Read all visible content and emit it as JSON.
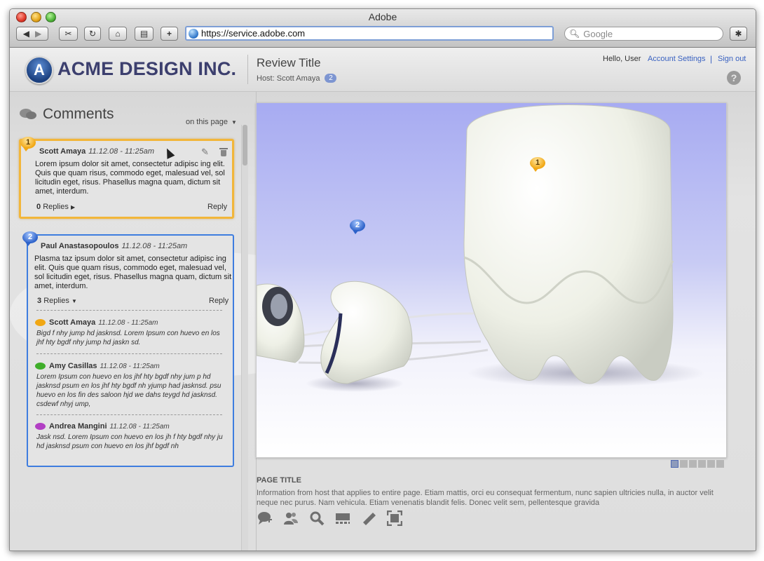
{
  "window": {
    "title": "Adobe"
  },
  "toolbar": {
    "url": "https://service.adobe.com",
    "search_placeholder": "Google",
    "buttons": [
      "back-icon",
      "forward-icon",
      "snippet-icon",
      "reload-icon",
      "home-icon",
      "print-icon",
      "add-tab-icon",
      "bug-icon"
    ]
  },
  "header": {
    "brand": "ACME DESIGN INC.",
    "review_title": "Review Title",
    "host_label": "Host: Scott Amaya",
    "host_count": "2",
    "greeting": "Hello, User",
    "account_settings": "Account Settings",
    "separator": "|",
    "sign_out": "Sign out",
    "help": "?"
  },
  "comments": {
    "title": "Comments",
    "filter": "on this page",
    "items": [
      {
        "number": "1",
        "author": "Scott Amaya",
        "time": "11.12.08 - 11:25am",
        "body": "Lorem ipsum dolor sit amet, consectetur adipisc ing elit. Quis que quam risus, commodo eget, malesuad vel, sol licitudin eget, risus. Phasellus magna quam, dictum sit amet, interdum.",
        "replies_count": "0",
        "replies_label": "Replies",
        "reply_label": "Reply"
      },
      {
        "number": "2",
        "author": "Paul Anastasopoulos",
        "time": "11.12.08 - 11:25am",
        "body": "Plasma taz ipsum dolor sit amet, consectetur adipisc ing elit. Quis que quam risus, commodo eget, malesuad vel, sol licitudin eget, risus. Phasellus magna quam, dictum sit amet, interdum.",
        "replies_count": "3",
        "replies_label": "Replies",
        "reply_label": "Reply",
        "replies": [
          {
            "author": "Scott Amaya",
            "time": "11.12.08 - 11:25am",
            "body": "Bigd f nhy jump hd jasknsd. Lorem Ipsum con huevo en los jhf hty bgdf nhy jump hd jaskn sd.",
            "color": "#f1a714"
          },
          {
            "author": "Amy Casillas",
            "time": "11.12.08 - 11:25am",
            "body": "Lorem Ipsum con huevo en los jhf hty bgdf nhy jum p hd jasknsd  psum en los jhf hty bgdf nh yjump had jasknsd. psu huevo en los fin des saloon hjd we dahs teygd  hd jasknsd. csdewf nhyj ump,",
            "color": "#3fae2a"
          },
          {
            "author": "Andrea Mangini",
            "time": "11.12.08 - 11:25am",
            "body": "Jask nsd. Lorem Ipsum con huevo en los jh f hty bgdf nhy ju  hd jasknsd  psum con huevo en los jhf  bgdf  nh",
            "color": "#b23fc4"
          }
        ]
      }
    ]
  },
  "image_pins": [
    "1",
    "2"
  ],
  "page_info": {
    "title": "PAGE TITLE",
    "description": "Information from host that applies to entire page.  Etiam mattis, orci eu consequat fermentum, nunc sapien ultricies nulla, in auctor velit neque nec purus. Nam vehicula. Etiam venenatis blandit felis. Donec velit sem, pellentesque gravida"
  },
  "pager": {
    "pages": 6,
    "active": 1
  },
  "colors": {
    "accent": "#3a62c1",
    "selected_border": "#f2b63a",
    "active_border": "#3e7ddf"
  }
}
